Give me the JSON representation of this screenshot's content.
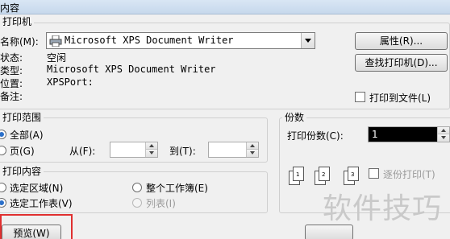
{
  "window": {
    "title_fragment": "内容"
  },
  "printer_section": {
    "group_label": "打印机",
    "name_label": "名称(M):",
    "printer_name": "Microsoft XPS Document Writer",
    "status_label": "状态:",
    "status_value": "空闲",
    "type_label": "类型:",
    "type_value": "Microsoft XPS Document Writer",
    "location_label": "位置:",
    "location_value": "XPSPort:",
    "comment_label": "备注:",
    "properties_button": "属性(R)...",
    "find_printer_button": "查找打印机(D)...",
    "print_to_file_label": "打印到文件(L)"
  },
  "range_section": {
    "group_label": "打印范围",
    "all_label": "全部(A)",
    "pages_label": "页(G)",
    "from_label": "从(F):",
    "to_label": "到(T):",
    "from_value": "",
    "to_value": ""
  },
  "content_section": {
    "group_label": "打印内容",
    "selection_label": "选定区域(N)",
    "entire_workbook_label": "整个工作簿(E)",
    "active_sheets_label": "选定工作表(V)",
    "list_label": "列表(I)"
  },
  "copies_section": {
    "group_label": "份数",
    "copies_label": "打印份数(C):",
    "copies_value": "1",
    "collate_label": "逐份打印(T)"
  },
  "footer": {
    "preview_button": "预览(W)"
  },
  "watermark_text": "软件技巧"
}
